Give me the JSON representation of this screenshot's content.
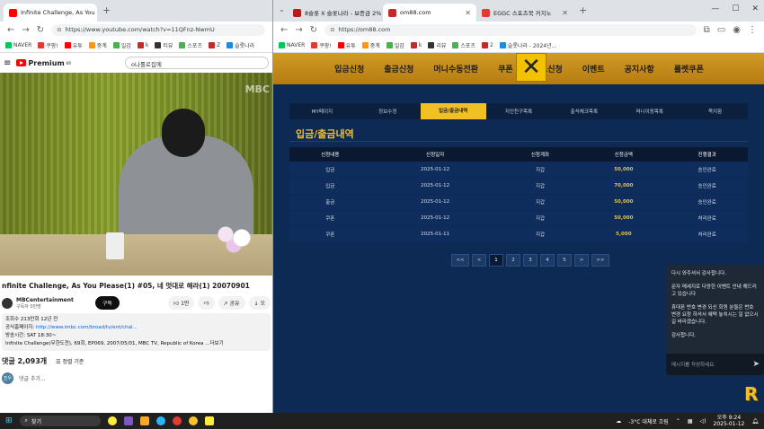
{
  "left": {
    "tabs": [
      {
        "label": "Infinite Challenge, As You"
      }
    ],
    "url": "https://www.youtube.com/watch?v=11QFnz-NwmU",
    "bookmarks": [
      "NAVER",
      "쿠팡!",
      "유튜",
      "중계",
      "일감",
      "k",
      "티뷰",
      "스포츠",
      "Z",
      "슬롯나라"
    ],
    "yt": {
      "premium": "Premium",
      "premium_sup": "KR",
      "search": "o나롤로집에",
      "channel_logo": "MBC",
      "title": "nfinite Challenge, As You Please(1) #05, 네 멋대로 해라(1) 20070901",
      "channel": "MBCentertainment",
      "subs": "구독자 0만명",
      "subscribe": "구독",
      "likes": "1만",
      "share": "공유",
      "download": "오",
      "desc_line1": "조회수 213만회 12년 전",
      "desc_line2_prefix": "공식홈페이지:",
      "desc_link": "http://www.imbc.com/broad/tv/ent/chal...",
      "desc_line3": "방송시간: SAT 18:30~",
      "desc_line4": "Infinite Challenge(무한도전), 69회, EP069, 2007/05/01, MBC TV, Republic of Korea ...더보기",
      "comments_count": "댓글 2,093개",
      "sort": "정렬 기준",
      "avatar": "진우",
      "comment_placeholder": "댓글 추가..."
    }
  },
  "right": {
    "tabs": [
      {
        "label": "8슬롯 X 슬롯나라 - 보증금 2%"
      },
      {
        "label": "om88.com"
      },
      {
        "label": "EGGC 스포츠북 커지노"
      }
    ],
    "url": "https://om88.com",
    "bookmarks": [
      "NAVER",
      "쿠팡!",
      "유튜",
      "중계",
      "일감",
      "k",
      "리뷰",
      "스포츠",
      "2",
      "슬롯나라 - 2024년..."
    ],
    "nav": [
      "입금신청",
      "출금신청",
      "머니수동전환",
      "쿠폰",
      "콤프신청",
      "이벤트",
      "공지사항",
      "룰렛쿠폰"
    ],
    "close_symbol": "✕",
    "subtabs": [
      "MY페이지",
      "정보수정",
      "입금/출금내역",
      "지인친구목록",
      "출석체크목록",
      "머니이동목록",
      "쪽지함"
    ],
    "active_subtab": 2,
    "page_title": "입금/출금내역",
    "table": {
      "headers": [
        "신청내용",
        "신청일자",
        "신청계좌",
        "신청금액",
        "진행결과"
      ],
      "rows": [
        [
          "입금",
          "2025-01-12",
          "지갑",
          "50,000",
          "승인완료"
        ],
        [
          "입금",
          "2025-01-12",
          "지갑",
          "70,000",
          "승인완료"
        ],
        [
          "출금",
          "2025-01-12",
          "지갑",
          "50,000",
          "승인완료"
        ],
        [
          "쿠폰",
          "2025-01-12",
          "지갑",
          "50,000",
          "처리완료"
        ],
        [
          "쿠폰",
          "2025-01-11",
          "지갑",
          "5,000",
          "처리완료"
        ]
      ]
    },
    "pager": [
      "<<",
      "<",
      "1",
      "2",
      "3",
      "4",
      "5",
      ">",
      ">>"
    ],
    "pager_active": 2,
    "chat": {
      "msg1": "다시 와주셔서 감사합니다.",
      "msg2": "문자 메세지로 다양한 이벤트 안내 해드리고 있습니다",
      "msg3": "휴대폰 번호 변경 되신 회원 분들은 번호 변경 요청 하셔서 혜택 놓치시는 일 없으시길 바라겠습니다.",
      "msg4": "감사합니다.",
      "placeholder": "메시지를 작성하세요.",
      "send": "➤"
    },
    "logo": "R"
  },
  "taskbar": {
    "search": "찾기",
    "weather": "-3°C  대체로 흐림",
    "time": "오후 9:24",
    "date": "2025-01-12"
  }
}
